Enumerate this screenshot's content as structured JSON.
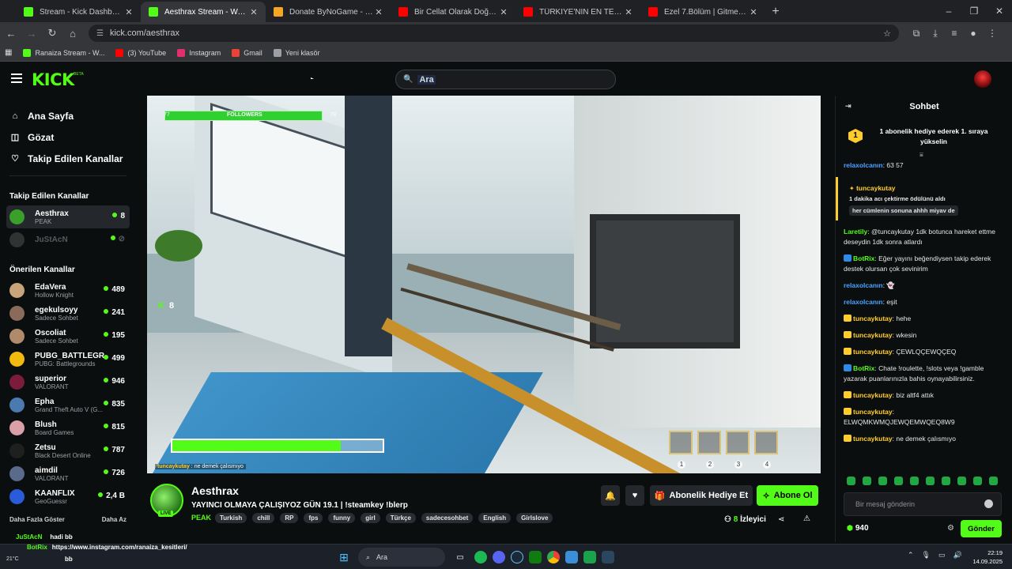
{
  "browser": {
    "tabs": [
      {
        "title": "Stream - Kick Dashboard",
        "color": "#53fc18",
        "active": false
      },
      {
        "title": "Aesthrax Stream - Watch Live o",
        "color": "#53fc18",
        "active": true
      },
      {
        "title": "Donate ByNoGame - Gelen/Gi",
        "color": "#f5a623",
        "active": false
      },
      {
        "title": "Bir Cellat Olarak Doğsaydın? - Y",
        "color": "#ff0000",
        "active": false
      },
      {
        "title": "TÜRKİYE'NİN EN TEHLİKELİ SEH",
        "color": "#ff0000",
        "active": false
      },
      {
        "title": "Ezel 7.Bölüm | Gitmek - Kalmak",
        "color": "#ff0000",
        "active": false
      }
    ],
    "url": "kick.com/aesthrax",
    "bookmarks": [
      {
        "label": "Ranaiza Stream - W...",
        "color": "#53fc18"
      },
      {
        "label": "(3) YouTube",
        "color": "#ff0000"
      },
      {
        "label": "Instagram",
        "color": "#e1306c"
      },
      {
        "label": "Gmail",
        "color": "#ea4335"
      },
      {
        "label": "Yeni klasör",
        "color": "#9aa0a6"
      }
    ]
  },
  "header": {
    "logo": "KICK",
    "beta": "BETA",
    "search_value": "Ara"
  },
  "sidebar": {
    "nav": [
      {
        "label": "Ana Sayfa",
        "icon": "home-icon"
      },
      {
        "label": "Gözat",
        "icon": "browse-icon"
      },
      {
        "label": "Takip Edilen Kanallar",
        "icon": "heart-icon"
      }
    ],
    "following_title": "Takip Edilen Kanallar",
    "following": [
      {
        "name": "Aesthrax",
        "category": "PEAK",
        "viewers": "8",
        "color": "#3aa02a",
        "active": true,
        "online": true
      },
      {
        "name": "JuStAcN",
        "category": "",
        "viewers": "",
        "color": "#777777",
        "active": false,
        "online": false
      }
    ],
    "recommended_title": "Önerilen Kanallar",
    "recommended": [
      {
        "name": "EdaVera",
        "category": "Hollow Knight",
        "viewers": "489",
        "color": "#c9a47a"
      },
      {
        "name": "egekulsoyy",
        "category": "Sadece Sohbet",
        "viewers": "241",
        "color": "#8a6a5a"
      },
      {
        "name": "Oscoliat",
        "category": "Sadece Sohbet",
        "viewers": "195",
        "color": "#b08b6b"
      },
      {
        "name": "PUBG_BATTLEGR...",
        "category": "PUBG: Battlegrounds",
        "viewers": "499",
        "color": "#f2b90f"
      },
      {
        "name": "superior",
        "category": "VALORANT",
        "viewers": "946",
        "color": "#7a1c3a"
      },
      {
        "name": "Epha",
        "category": "Grand Theft Auto V (G...",
        "viewers": "835",
        "color": "#4a7ab0"
      },
      {
        "name": "Blush",
        "category": "Board Games",
        "viewers": "815",
        "color": "#d9a0a8"
      },
      {
        "name": "Zetsu",
        "category": "Black Desert Online",
        "viewers": "787",
        "color": "#1f1f1f"
      },
      {
        "name": "aimdil",
        "category": "VALORANT",
        "viewers": "726",
        "color": "#5a6a8a"
      },
      {
        "name": "KAANFLIX",
        "category": "GeoGuessr",
        "viewers": "2,4 B",
        "color": "#2a5cd9"
      }
    ],
    "show_more": "Daha Fazla Göster",
    "show_less": "Daha Az"
  },
  "video": {
    "followers_left": "77",
    "followers_label": "FOLLOWERS",
    "followers_right": "78",
    "kick_viewers": "8",
    "health_fraction": 0.8,
    "chat_overlay_user": "tuncaykutay",
    "chat_overlay_text": "ne demek çalısmıyo",
    "slots": [
      "1",
      "2",
      "3",
      "4"
    ]
  },
  "channel": {
    "name": "Aesthrax",
    "live": "LIVE",
    "title": "YAYINCI OLMAYA ÇALIŞIYOZ GÜN 19.1 | !steamkey !blerp",
    "category": "PEAK",
    "tags": [
      "Turkish",
      "chill",
      "RP",
      "fps",
      "funny",
      "girl",
      "Türkçe",
      "sadecesohbet",
      "English",
      "Girlslove"
    ],
    "gift_label": "Abonelik Hediye Et",
    "subscribe_label": "Abone Ol",
    "viewers": "8",
    "viewers_label": "İzleyici"
  },
  "chat": {
    "title": "Sohbet",
    "gift_rank": "1",
    "gift_text": "1 abonelik hediye ederek 1. sıraya yükselin",
    "messages": [
      {
        "user": "relaxolcanın",
        "color": "#4aa3ff",
        "text": "63 57",
        "badge": ""
      },
      {
        "type": "redeem",
        "user": "tuncaykutay",
        "reward": "1 dakika acı çektirme ödülünü aldı",
        "message": "her cümlenin sonuna ahhh miyav de"
      },
      {
        "user": "Laretily",
        "color": "#53fc18",
        "text": "@tuncaykutay 1dk botunca hareket ettme deseydin 1dk sonra atlardı",
        "badge": ""
      },
      {
        "user": "BotRix",
        "color": "#53fc18",
        "text": "Eğer yayını beğendiysen takip ederek destek olursan çok sevinirim",
        "badge": "#2e8ae6"
      },
      {
        "user": "relaxolcanın",
        "color": "#4aa3ff",
        "text": "👻",
        "badge": ""
      },
      {
        "user": "relaxolcanın",
        "color": "#4aa3ff",
        "text": "eşit",
        "badge": ""
      },
      {
        "user": "tuncaykutay",
        "color": "#ffcd2b",
        "text": "hehe",
        "badge": "#ffcd2b"
      },
      {
        "user": "tuncaykutay",
        "color": "#ffcd2b",
        "text": "wkesin",
        "badge": "#ffcd2b"
      },
      {
        "user": "tuncaykutay",
        "color": "#ffcd2b",
        "text": "ÇEWLQÇEWQÇEQ",
        "badge": "#ffcd2b"
      },
      {
        "user": "BotRix",
        "color": "#53fc18",
        "text": "Chate !roulette, !slots veya !gamble yazarak puanlarınızla bahis oynayabilirsiniz.",
        "badge": "#2e8ae6"
      },
      {
        "user": "tuncaykutay",
        "color": "#ffcd2b",
        "text": "biz altf4 attık",
        "badge": "#ffcd2b"
      },
      {
        "user": "tuncaykutay",
        "color": "#ffcd2b",
        "text": "ELWQMKWMQJEWQEMWQEQ8W9",
        "badge": "#ffcd2b"
      },
      {
        "user": "tuncaykutay",
        "color": "#ffcd2b",
        "text": "ne demek çalısmıyo",
        "badge": "#ffcd2b"
      }
    ],
    "input_placeholder": "Bir mesaj gönderin",
    "points": "940",
    "send_label": "Gönder"
  },
  "notifications": {
    "line1_user": "JuStAcN",
    "line1_text": "hadi bb",
    "line2_user": "BotRix",
    "line2_text": "https://www.instagram.com/ranaiza_kesitleri/",
    "line3_text": "bb"
  },
  "taskbar": {
    "weather": "21°C",
    "search": "Ara",
    "time": "22:19",
    "date": "14.09.2025"
  }
}
